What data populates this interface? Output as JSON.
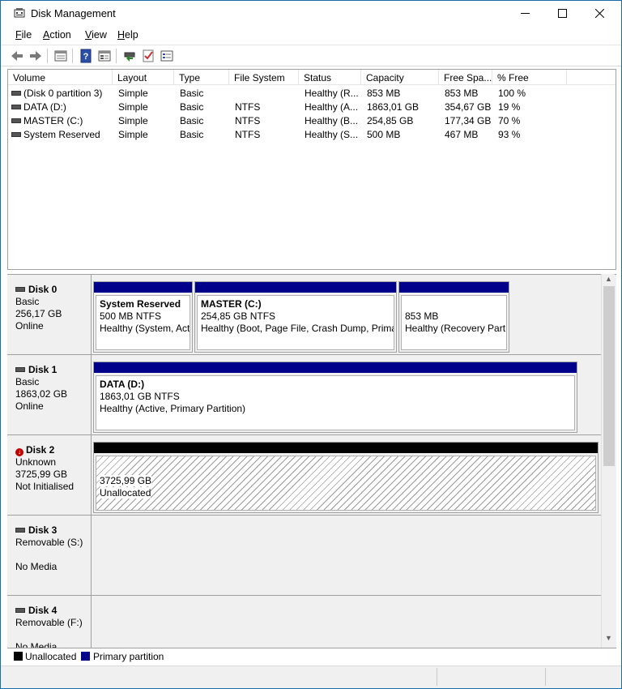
{
  "window": {
    "title": "Disk Management"
  },
  "menu": [
    {
      "label": "File",
      "key": "F",
      "rest": "ile"
    },
    {
      "label": "Action",
      "key": "A",
      "rest": "ction"
    },
    {
      "label": "View",
      "key": "V",
      "rest": "iew"
    },
    {
      "label": "Help",
      "key": "H",
      "rest": "elp"
    }
  ],
  "toolbar": {
    "icons": [
      "back-icon",
      "forward-icon",
      "properties-icon",
      "help-icon",
      "disk-list-icon",
      "connect-icon",
      "check-icon",
      "settings-icon"
    ]
  },
  "columns": [
    "Volume",
    "Layout",
    "Type",
    "File System",
    "Status",
    "Capacity",
    "Free Spa...",
    "% Free"
  ],
  "volumes": [
    {
      "volume": "(Disk 0 partition 3)",
      "layout": "Simple",
      "type": "Basic",
      "fs": "",
      "status": "Healthy (R...",
      "capacity": "853 MB",
      "free": "853 MB",
      "pct": "100 %"
    },
    {
      "volume": "DATA (D:)",
      "layout": "Simple",
      "type": "Basic",
      "fs": "NTFS",
      "status": "Healthy (A...",
      "capacity": "1863,01 GB",
      "free": "354,67 GB",
      "pct": "19 %"
    },
    {
      "volume": "MASTER (C:)",
      "layout": "Simple",
      "type": "Basic",
      "fs": "NTFS",
      "status": "Healthy (B...",
      "capacity": "254,85 GB",
      "free": "177,34 GB",
      "pct": "70 %"
    },
    {
      "volume": "System Reserved",
      "layout": "Simple",
      "type": "Basic",
      "fs": "NTFS",
      "status": "Healthy (S...",
      "capacity": "500 MB",
      "free": "467 MB",
      "pct": "93 %"
    }
  ],
  "disks": [
    {
      "name": "Disk 0",
      "line1": "Basic",
      "line2": "256,17 GB",
      "line3": "Online",
      "partitions": [
        {
          "title": "System Reserved",
          "size": "500 MB NTFS",
          "status": "Healthy (System, Act"
        },
        {
          "title": "MASTER  (C:)",
          "size": "254,85 GB NTFS",
          "status": "Healthy (Boot, Page File, Crash Dump, Prima"
        },
        {
          "title": "",
          "size": "853 MB",
          "status": "Healthy (Recovery Part"
        }
      ]
    },
    {
      "name": "Disk 1",
      "line1": "Basic",
      "line2": "1863,02 GB",
      "line3": "Online",
      "partitions": [
        {
          "title": "DATA  (D:)",
          "size": "1863,01 GB NTFS",
          "status": "Healthy (Active, Primary Partition)"
        }
      ]
    },
    {
      "name": "Disk 2",
      "line1": "Unknown",
      "line2": "3725,99 GB",
      "line3": "Not Initialised",
      "partitions": [
        {
          "title": "",
          "size": "3725,99 GB",
          "status": "Unallocated"
        }
      ]
    },
    {
      "name": "Disk 3",
      "line1": "Removable (S:)",
      "line2": "",
      "line3": "No Media",
      "partitions": []
    },
    {
      "name": "Disk 4",
      "line1": "Removable (F:)",
      "line2": "",
      "line3": "No Media",
      "partitions": []
    }
  ],
  "legend": [
    {
      "label": "Unallocated",
      "color": "#000000"
    },
    {
      "label": "Primary partition",
      "color": "#00008b"
    }
  ]
}
